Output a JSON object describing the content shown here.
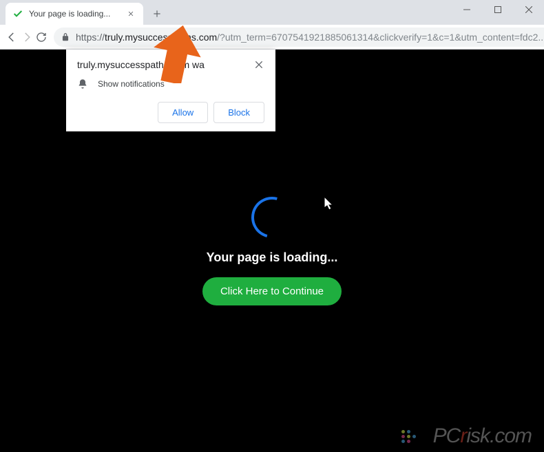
{
  "window": {
    "tab_title": "Your page is loading...",
    "url_https": "https://",
    "url_domain": "truly.mysuccesspaths.com",
    "url_path": "/?utm_term=6707541921885061314&clickverify=1&c=1&utm_content=fdc2..."
  },
  "notification": {
    "origin_text": "truly.mysuccesspaths.com wa",
    "body_text": "Show notifications",
    "allow_label": "Allow",
    "block_label": "Block"
  },
  "page": {
    "loading_text": "Your page is loading...",
    "continue_label": "Click Here to Continue"
  },
  "watermark": {
    "pc": "PC",
    "r": "r",
    "rest": "isk.com"
  }
}
